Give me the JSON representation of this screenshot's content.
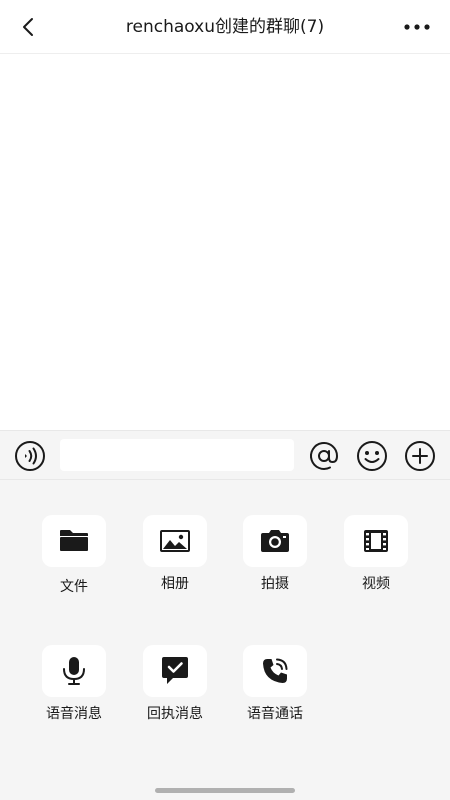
{
  "header": {
    "title": "renchaoxu创建的群聊(7)",
    "back_icon": "chevron-left-icon",
    "more_icon": "more-horizontal-icon"
  },
  "input_bar": {
    "voice_icon": "voice-input-icon",
    "input_value": "",
    "mention_icon": "at-sign-icon",
    "emoji_icon": "emoji-icon",
    "plus_icon": "plus-circle-icon"
  },
  "panel": {
    "items": [
      {
        "label": "文件",
        "icon": "folder-icon"
      },
      {
        "label": "相册",
        "icon": "image-icon"
      },
      {
        "label": "拍摄",
        "icon": "camera-icon"
      },
      {
        "label": "视频",
        "icon": "film-icon"
      },
      {
        "label": "语音消息",
        "icon": "microphone-icon"
      },
      {
        "label": "回执消息",
        "icon": "receipt-check-icon"
      },
      {
        "label": "语音通话",
        "icon": "phone-call-icon"
      }
    ]
  },
  "colors": {
    "background": "#ffffff",
    "panel": "#f5f5f5",
    "icon": "#1a1a1a"
  }
}
